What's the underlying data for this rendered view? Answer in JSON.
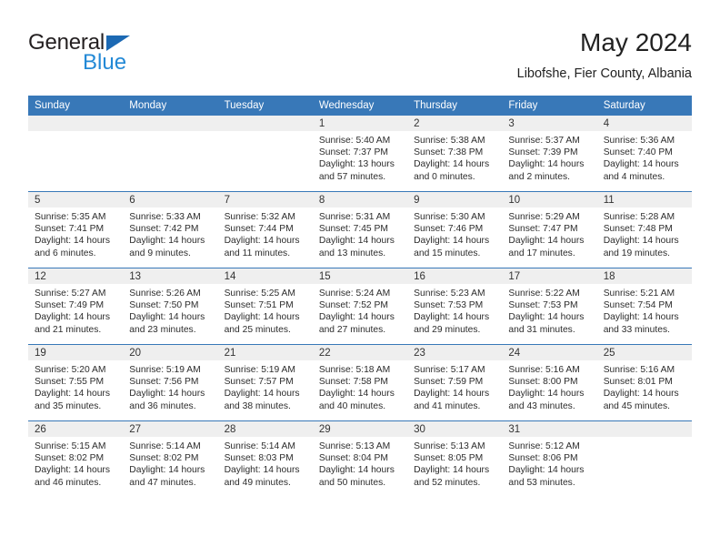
{
  "brand": {
    "name_part1": "General",
    "name_part2": "Blue",
    "accent_color": "#2389d6",
    "triangle_color": "#1c69b3"
  },
  "header": {
    "month_title": "May 2024",
    "location": "Libofshe, Fier County, Albania"
  },
  "theme": {
    "header_bg": "#3878b8",
    "daynum_bg": "#efefef",
    "text_color": "#2c2c2c"
  },
  "weekdays": [
    "Sunday",
    "Monday",
    "Tuesday",
    "Wednesday",
    "Thursday",
    "Friday",
    "Saturday"
  ],
  "labels": {
    "sunrise": "Sunrise:",
    "sunset": "Sunset:",
    "daylight": "Daylight:"
  },
  "weeks": [
    [
      {
        "day": "",
        "empty": true
      },
      {
        "day": "",
        "empty": true
      },
      {
        "day": "",
        "empty": true
      },
      {
        "day": "1",
        "sunrise": "Sunrise: 5:40 AM",
        "sunset": "Sunset: 7:37 PM",
        "daylight": "Daylight: 13 hours and 57 minutes."
      },
      {
        "day": "2",
        "sunrise": "Sunrise: 5:38 AM",
        "sunset": "Sunset: 7:38 PM",
        "daylight": "Daylight: 14 hours and 0 minutes."
      },
      {
        "day": "3",
        "sunrise": "Sunrise: 5:37 AM",
        "sunset": "Sunset: 7:39 PM",
        "daylight": "Daylight: 14 hours and 2 minutes."
      },
      {
        "day": "4",
        "sunrise": "Sunrise: 5:36 AM",
        "sunset": "Sunset: 7:40 PM",
        "daylight": "Daylight: 14 hours and 4 minutes."
      }
    ],
    [
      {
        "day": "5",
        "sunrise": "Sunrise: 5:35 AM",
        "sunset": "Sunset: 7:41 PM",
        "daylight": "Daylight: 14 hours and 6 minutes."
      },
      {
        "day": "6",
        "sunrise": "Sunrise: 5:33 AM",
        "sunset": "Sunset: 7:42 PM",
        "daylight": "Daylight: 14 hours and 9 minutes."
      },
      {
        "day": "7",
        "sunrise": "Sunrise: 5:32 AM",
        "sunset": "Sunset: 7:44 PM",
        "daylight": "Daylight: 14 hours and 11 minutes."
      },
      {
        "day": "8",
        "sunrise": "Sunrise: 5:31 AM",
        "sunset": "Sunset: 7:45 PM",
        "daylight": "Daylight: 14 hours and 13 minutes."
      },
      {
        "day": "9",
        "sunrise": "Sunrise: 5:30 AM",
        "sunset": "Sunset: 7:46 PM",
        "daylight": "Daylight: 14 hours and 15 minutes."
      },
      {
        "day": "10",
        "sunrise": "Sunrise: 5:29 AM",
        "sunset": "Sunset: 7:47 PM",
        "daylight": "Daylight: 14 hours and 17 minutes."
      },
      {
        "day": "11",
        "sunrise": "Sunrise: 5:28 AM",
        "sunset": "Sunset: 7:48 PM",
        "daylight": "Daylight: 14 hours and 19 minutes."
      }
    ],
    [
      {
        "day": "12",
        "sunrise": "Sunrise: 5:27 AM",
        "sunset": "Sunset: 7:49 PM",
        "daylight": "Daylight: 14 hours and 21 minutes."
      },
      {
        "day": "13",
        "sunrise": "Sunrise: 5:26 AM",
        "sunset": "Sunset: 7:50 PM",
        "daylight": "Daylight: 14 hours and 23 minutes."
      },
      {
        "day": "14",
        "sunrise": "Sunrise: 5:25 AM",
        "sunset": "Sunset: 7:51 PM",
        "daylight": "Daylight: 14 hours and 25 minutes."
      },
      {
        "day": "15",
        "sunrise": "Sunrise: 5:24 AM",
        "sunset": "Sunset: 7:52 PM",
        "daylight": "Daylight: 14 hours and 27 minutes."
      },
      {
        "day": "16",
        "sunrise": "Sunrise: 5:23 AM",
        "sunset": "Sunset: 7:53 PM",
        "daylight": "Daylight: 14 hours and 29 minutes."
      },
      {
        "day": "17",
        "sunrise": "Sunrise: 5:22 AM",
        "sunset": "Sunset: 7:53 PM",
        "daylight": "Daylight: 14 hours and 31 minutes."
      },
      {
        "day": "18",
        "sunrise": "Sunrise: 5:21 AM",
        "sunset": "Sunset: 7:54 PM",
        "daylight": "Daylight: 14 hours and 33 minutes."
      }
    ],
    [
      {
        "day": "19",
        "sunrise": "Sunrise: 5:20 AM",
        "sunset": "Sunset: 7:55 PM",
        "daylight": "Daylight: 14 hours and 35 minutes."
      },
      {
        "day": "20",
        "sunrise": "Sunrise: 5:19 AM",
        "sunset": "Sunset: 7:56 PM",
        "daylight": "Daylight: 14 hours and 36 minutes."
      },
      {
        "day": "21",
        "sunrise": "Sunrise: 5:19 AM",
        "sunset": "Sunset: 7:57 PM",
        "daylight": "Daylight: 14 hours and 38 minutes."
      },
      {
        "day": "22",
        "sunrise": "Sunrise: 5:18 AM",
        "sunset": "Sunset: 7:58 PM",
        "daylight": "Daylight: 14 hours and 40 minutes."
      },
      {
        "day": "23",
        "sunrise": "Sunrise: 5:17 AM",
        "sunset": "Sunset: 7:59 PM",
        "daylight": "Daylight: 14 hours and 41 minutes."
      },
      {
        "day": "24",
        "sunrise": "Sunrise: 5:16 AM",
        "sunset": "Sunset: 8:00 PM",
        "daylight": "Daylight: 14 hours and 43 minutes."
      },
      {
        "day": "25",
        "sunrise": "Sunrise: 5:16 AM",
        "sunset": "Sunset: 8:01 PM",
        "daylight": "Daylight: 14 hours and 45 minutes."
      }
    ],
    [
      {
        "day": "26",
        "sunrise": "Sunrise: 5:15 AM",
        "sunset": "Sunset: 8:02 PM",
        "daylight": "Daylight: 14 hours and 46 minutes."
      },
      {
        "day": "27",
        "sunrise": "Sunrise: 5:14 AM",
        "sunset": "Sunset: 8:02 PM",
        "daylight": "Daylight: 14 hours and 47 minutes."
      },
      {
        "day": "28",
        "sunrise": "Sunrise: 5:14 AM",
        "sunset": "Sunset: 8:03 PM",
        "daylight": "Daylight: 14 hours and 49 minutes."
      },
      {
        "day": "29",
        "sunrise": "Sunrise: 5:13 AM",
        "sunset": "Sunset: 8:04 PM",
        "daylight": "Daylight: 14 hours and 50 minutes."
      },
      {
        "day": "30",
        "sunrise": "Sunrise: 5:13 AM",
        "sunset": "Sunset: 8:05 PM",
        "daylight": "Daylight: 14 hours and 52 minutes."
      },
      {
        "day": "31",
        "sunrise": "Sunrise: 5:12 AM",
        "sunset": "Sunset: 8:06 PM",
        "daylight": "Daylight: 14 hours and 53 minutes."
      },
      {
        "day": "",
        "empty": true
      }
    ]
  ]
}
